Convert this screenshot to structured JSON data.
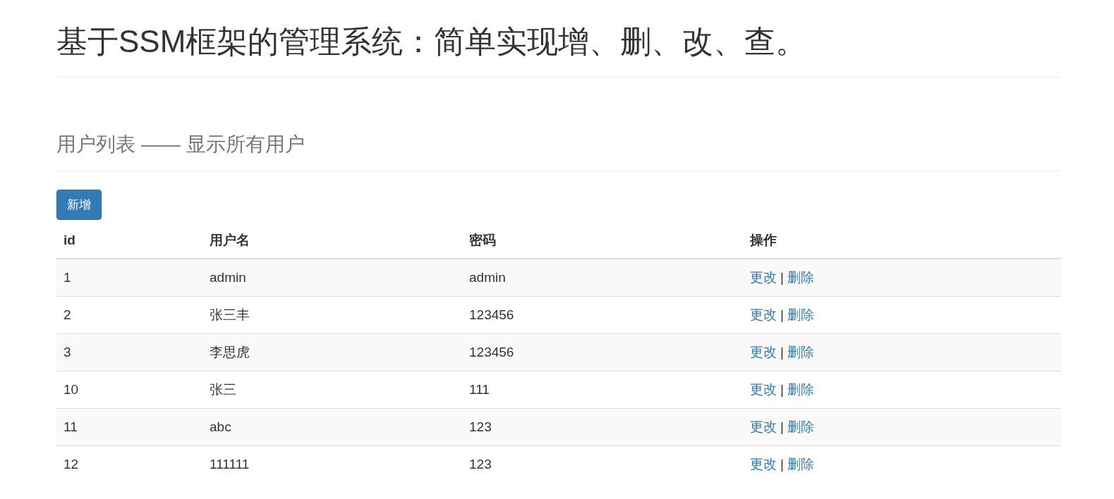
{
  "page_title": "基于SSM框架的管理系统：简单实现增、删、改、查。",
  "section_title": "用户列表 —— 显示所有用户",
  "add_button": "新增",
  "table": {
    "columns": [
      "id",
      "用户名",
      "密码",
      "操作"
    ],
    "rows": [
      {
        "id": "1",
        "username": "admin",
        "password": "admin",
        "actions": [
          "更改",
          "删除"
        ],
        "separator": "|"
      },
      {
        "id": "2",
        "username": "张三丰",
        "password": "123456",
        "actions": [
          "更改",
          "删除"
        ],
        "separator": "|"
      },
      {
        "id": "3",
        "username": "李思虎",
        "password": "123456",
        "actions": [
          "更改",
          "删除"
        ],
        "separator": "|"
      },
      {
        "id": "10",
        "username": "张三",
        "password": "111",
        "actions": [
          "更改",
          "删除"
        ],
        "separator": "|"
      },
      {
        "id": "11",
        "username": "abc",
        "password": "123",
        "actions": [
          "更改",
          "删除"
        ],
        "separator": "|"
      },
      {
        "id": "12",
        "username": "111111",
        "password": "123",
        "actions": [
          "更改",
          "删除"
        ],
        "separator": "|"
      }
    ]
  }
}
